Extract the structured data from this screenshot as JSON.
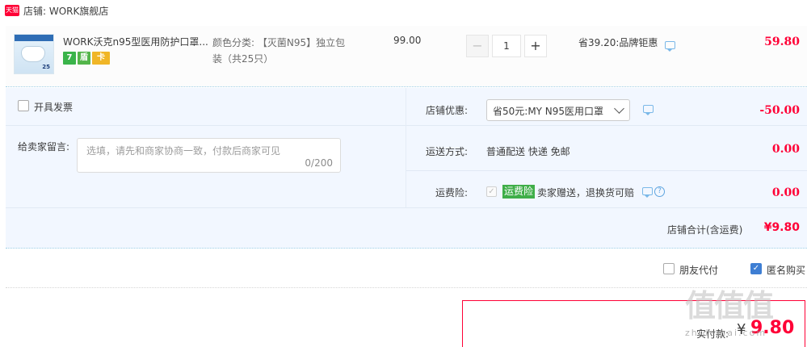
{
  "store": {
    "badge": "天猫",
    "name": "店铺: WORK旗舰店"
  },
  "item": {
    "title": "WORK沃克n95型医用防护口罩...",
    "thumb_label": "25",
    "badges": [
      "7",
      "盾",
      "卡"
    ],
    "sku_line1": "颜色分类: 【灭菌N95】独立包",
    "sku_line2": "装（共25只）",
    "unit_price": "99.00",
    "quantity": "1",
    "qty_minus": "−",
    "qty_plus": "+",
    "promo": "省39.20:品牌钜惠",
    "subtotal": "59.80"
  },
  "options": {
    "invoice_label": "开具发票",
    "message_label": "给卖家留言:",
    "message_placeholder": "选填，请先和商家协商一致，付款后商家可见",
    "message_count": "0/200",
    "store_discount_label": "店铺优惠:",
    "store_discount_value": "省50元:MY N95医用口罩",
    "store_discount_amount": "-50.00",
    "shipping_label": "运送方式:",
    "shipping_value": "普通配送 快递 免邮",
    "shipping_amount": "0.00",
    "insurance_label": "运费险:",
    "insurance_tag": "运费险",
    "insurance_desc": "卖家赠送，退换货可赔",
    "insurance_amount": "0.00"
  },
  "store_total": {
    "label": "店铺合计(含运费)",
    "amount": "¥9.80"
  },
  "footer": {
    "friend_pay_label": "朋友代付",
    "anonymous_label": "匿名购买",
    "anonymous_checked": true,
    "pay_label": "实付款:",
    "pay_yen": "¥",
    "pay_amount": "9.80"
  },
  "watermark": {
    "text": "值值值",
    "url": "zhidemai.com"
  },
  "colors": {
    "accent_red": "#ff0036",
    "panel_blue": "#f2f7ff",
    "checkbox_blue": "#3e7ed3",
    "insurance_green": "#3fae48"
  }
}
